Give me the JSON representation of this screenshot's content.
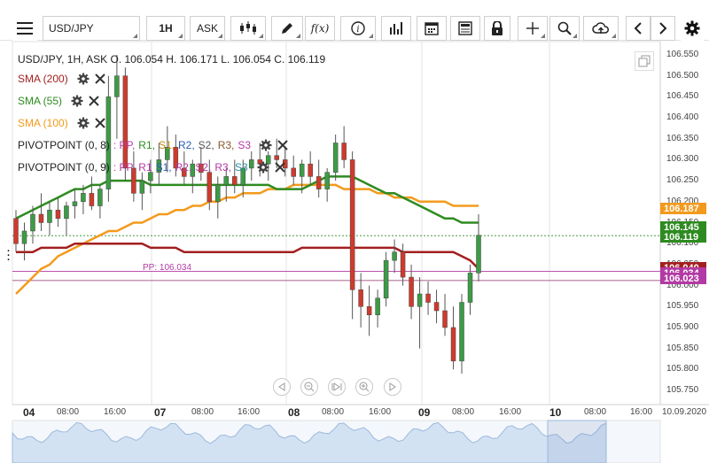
{
  "toolbar": {
    "menu_icon": "hamburger-icon",
    "symbol": "USD/JPY",
    "timeframe": "1H",
    "price_type": "ASK",
    "buttons": [
      {
        "name": "chart-type-button",
        "icon": "candlestick-icon"
      },
      {
        "name": "draw-button",
        "icon": "pencil-icon"
      },
      {
        "name": "indicators-button",
        "icon": "fx-icon",
        "label": "f(x)"
      },
      {
        "name": "info-button",
        "icon": "info-icon"
      },
      {
        "name": "volume-button",
        "icon": "bars-icon"
      },
      {
        "name": "calendar-button",
        "icon": "calendar-icon"
      },
      {
        "name": "news-button",
        "icon": "news-icon"
      },
      {
        "name": "lock-button",
        "icon": "lock-icon"
      },
      {
        "name": "crosshair-button",
        "icon": "crosshair-icon"
      },
      {
        "name": "zoom-button",
        "icon": "zoom-icon"
      },
      {
        "name": "cloud-button",
        "icon": "cloud-upload-icon"
      },
      {
        "name": "prev-button",
        "icon": "chevron-left-icon"
      },
      {
        "name": "next-button",
        "icon": "chevron-right-icon"
      },
      {
        "name": "settings-button",
        "icon": "gear-icon"
      }
    ]
  },
  "legend": {
    "ohlc": "USD/JPY, 1H, ASK   O. 106.054  H. 106.171  L. 106.054  C. 106.119",
    "indicators": [
      {
        "label": "SMA (200)",
        "color": "#a31f1f"
      },
      {
        "label": "SMA (55)",
        "color": "#2e8b20"
      },
      {
        "label": "SMA (100)",
        "color": "#f39a1c"
      }
    ],
    "pivots": [
      {
        "label": "PIVOTPOINT (0, 8)",
        "items": [
          {
            "t": ": PP,",
            "c": "#b33aa4"
          },
          {
            "t": "R1,",
            "c": "#2e8b20"
          },
          {
            "t": "S1,",
            "c": "#c08a14"
          },
          {
            "t": "R2,",
            "c": "#2a5bb5"
          },
          {
            "t": "S2,",
            "c": "#555555"
          },
          {
            "t": "R3,",
            "c": "#8a5a2b"
          },
          {
            "t": "S3",
            "c": "#b33aa4"
          }
        ]
      },
      {
        "label": "PIVOTPOINT (0, 9)",
        "items": [
          {
            "t": ": PP,",
            "c": "#b33aa4"
          },
          {
            "t": "R1",
            "c": "#b33aa4"
          },
          {
            "t": "S1,",
            "c": "#2a5bb5"
          },
          {
            "t": "R2,",
            "c": "#b33aa4"
          },
          {
            "t": "S2,",
            "c": "#b33aa4"
          },
          {
            "t": "R3,",
            "c": "#b33aa4"
          },
          {
            "t": "S3",
            "c": "#2a8fa4"
          }
        ]
      }
    ]
  },
  "pp_label": "PP: 106.034",
  "price_axis": [
    "106.550",
    "106.500",
    "106.450",
    "106.400",
    "106.350",
    "106.300",
    "106.250",
    "106.200",
    "106.150",
    "106.100",
    "106.050",
    "106.000",
    "105.950",
    "105.900",
    "105.850",
    "105.800",
    "105.750"
  ],
  "price_tags": [
    {
      "value": "106.187",
      "color": "#f39a1c"
    },
    {
      "value": "106.145",
      "color": "#2e8b20"
    },
    {
      "value": "106.119",
      "color": "#2e8b20"
    },
    {
      "value": "106.040",
      "color": "#a31f1f"
    },
    {
      "value": "106.034",
      "color": "#b33aa4"
    },
    {
      "value": "106.023",
      "color": "#b33aa4"
    }
  ],
  "time_axis": [
    {
      "label": "04",
      "bold": true
    },
    {
      "label": "08:00"
    },
    {
      "label": "16:00"
    },
    {
      "label": "07",
      "bold": true
    },
    {
      "label": "08:00"
    },
    {
      "label": "16:00"
    },
    {
      "label": "08",
      "bold": true
    },
    {
      "label": "08:00"
    },
    {
      "label": "16:00"
    },
    {
      "label": "09",
      "bold": true
    },
    {
      "label": "08:00"
    },
    {
      "label": "16:00"
    },
    {
      "label": "10",
      "bold": true
    },
    {
      "label": "08:00"
    },
    {
      "label": "16:00"
    },
    {
      "label": "10.09.2020"
    }
  ],
  "chart_data": {
    "type": "candlestick",
    "symbol": "USD/JPY",
    "interval": "1H",
    "ylim": [
      105.72,
      106.58
    ],
    "candles": [
      [
        106.16,
        106.18,
        106.08,
        106.1
      ],
      [
        106.1,
        106.15,
        106.06,
        106.13
      ],
      [
        106.13,
        106.19,
        106.1,
        106.17
      ],
      [
        106.17,
        106.22,
        106.13,
        106.15
      ],
      [
        106.15,
        106.2,
        106.12,
        106.18
      ],
      [
        106.18,
        106.21,
        106.14,
        106.16
      ],
      [
        106.16,
        106.2,
        106.12,
        106.19
      ],
      [
        106.19,
        106.23,
        106.16,
        106.2
      ],
      [
        106.2,
        106.24,
        106.17,
        106.22
      ],
      [
        106.22,
        106.26,
        106.18,
        106.19
      ],
      [
        106.19,
        106.24,
        106.16,
        106.23
      ],
      [
        106.23,
        106.5,
        106.2,
        106.45
      ],
      [
        106.45,
        106.55,
        106.35,
        106.5
      ],
      [
        106.5,
        106.52,
        106.25,
        106.28
      ],
      [
        106.28,
        106.32,
        106.2,
        106.22
      ],
      [
        106.22,
        106.27,
        106.18,
        106.25
      ],
      [
        106.25,
        106.3,
        106.22,
        106.27
      ],
      [
        106.27,
        106.34,
        106.24,
        106.3
      ],
      [
        106.3,
        106.38,
        106.27,
        106.33
      ],
      [
        106.33,
        106.36,
        106.26,
        106.28
      ],
      [
        106.28,
        106.32,
        106.24,
        106.26
      ],
      [
        106.26,
        106.3,
        106.22,
        106.29
      ],
      [
        106.29,
        106.33,
        106.25,
        106.27
      ],
      [
        106.27,
        106.3,
        106.18,
        106.2
      ],
      [
        106.2,
        106.26,
        106.16,
        106.24
      ],
      [
        106.24,
        106.28,
        106.2,
        106.26
      ],
      [
        106.26,
        106.3,
        106.22,
        106.24
      ],
      [
        106.24,
        106.3,
        106.21,
        106.28
      ],
      [
        106.28,
        106.32,
        106.25,
        106.3
      ],
      [
        106.3,
        106.34,
        106.26,
        106.29
      ],
      [
        106.29,
        106.32,
        106.25,
        106.31
      ],
      [
        106.31,
        106.35,
        106.28,
        106.3
      ],
      [
        106.3,
        106.33,
        106.26,
        106.28
      ],
      [
        106.28,
        106.31,
        106.24,
        106.26
      ],
      [
        106.26,
        106.3,
        106.22,
        106.29
      ],
      [
        106.29,
        106.32,
        106.24,
        106.26
      ],
      [
        106.26,
        106.3,
        106.21,
        106.23
      ],
      [
        106.23,
        106.28,
        106.2,
        106.27
      ],
      [
        106.27,
        106.36,
        106.25,
        106.34
      ],
      [
        106.34,
        106.38,
        106.28,
        106.3
      ],
      [
        106.3,
        106.32,
        105.92,
        105.99
      ],
      [
        105.99,
        106.03,
        105.9,
        105.95
      ],
      [
        105.95,
        106.0,
        105.88,
        105.93
      ],
      [
        105.93,
        105.99,
        105.9,
        105.97
      ],
      [
        105.97,
        106.08,
        105.95,
        106.06
      ],
      [
        106.06,
        106.11,
        106.03,
        106.08
      ],
      [
        106.08,
        106.1,
        106.0,
        106.02
      ],
      [
        106.02,
        106.05,
        105.92,
        105.95
      ],
      [
        105.95,
        106.02,
        105.85,
        105.98
      ],
      [
        105.98,
        106.01,
        105.93,
        105.96
      ],
      [
        105.96,
        105.99,
        105.91,
        105.94
      ],
      [
        105.94,
        105.98,
        105.88,
        105.9
      ],
      [
        105.9,
        105.95,
        105.8,
        105.82
      ],
      [
        105.82,
        105.98,
        105.79,
        105.96
      ],
      [
        105.96,
        106.05,
        105.93,
        106.03
      ],
      [
        106.03,
        106.17,
        106.01,
        106.12
      ]
    ],
    "sma200": [
      106.08,
      106.08,
      106.08,
      106.09,
      106.09,
      106.09,
      106.09,
      106.1,
      106.1,
      106.1,
      106.1,
      106.1,
      106.1,
      106.1,
      106.1,
      106.1,
      106.09,
      106.09,
      106.09,
      106.09,
      106.08,
      106.08,
      106.08,
      106.08,
      106.08,
      106.08,
      106.08,
      106.08,
      106.08,
      106.08,
      106.08,
      106.08,
      106.08,
      106.08,
      106.09,
      106.09,
      106.09,
      106.09,
      106.09,
      106.09,
      106.09,
      106.09,
      106.09,
      106.09,
      106.09,
      106.09,
      106.08,
      106.08,
      106.08,
      106.08,
      106.08,
      106.08,
      106.08,
      106.07,
      106.06,
      106.04
    ],
    "sma55": [
      106.16,
      106.17,
      106.18,
      106.19,
      106.2,
      106.21,
      106.22,
      106.23,
      106.23,
      106.24,
      106.24,
      106.25,
      106.25,
      106.25,
      106.25,
      106.25,
      106.24,
      106.24,
      106.24,
      106.24,
      106.24,
      106.24,
      106.24,
      106.24,
      106.24,
      106.24,
      106.24,
      106.24,
      106.24,
      106.24,
      106.24,
      106.23,
      106.23,
      106.23,
      106.23,
      106.24,
      106.25,
      106.26,
      106.26,
      106.26,
      106.26,
      106.25,
      106.24,
      106.23,
      106.22,
      106.22,
      106.21,
      106.2,
      106.19,
      106.18,
      106.17,
      106.16,
      106.16,
      106.15,
      106.15,
      106.15
    ],
    "sma100": [
      105.98,
      106.0,
      106.02,
      106.04,
      106.05,
      106.07,
      106.08,
      106.09,
      106.1,
      106.11,
      106.12,
      106.13,
      106.13,
      106.14,
      106.15,
      106.15,
      106.16,
      106.17,
      106.17,
      106.18,
      106.18,
      106.19,
      106.19,
      106.2,
      106.2,
      106.21,
      106.21,
      106.22,
      106.22,
      106.22,
      106.23,
      106.23,
      106.23,
      106.24,
      106.24,
      106.24,
      106.24,
      106.24,
      106.24,
      106.23,
      106.23,
      106.23,
      106.23,
      106.22,
      106.22,
      106.21,
      106.21,
      106.21,
      106.2,
      106.2,
      106.2,
      106.2,
      106.19,
      106.19,
      106.19,
      106.19
    ],
    "pp_level": 106.034
  }
}
